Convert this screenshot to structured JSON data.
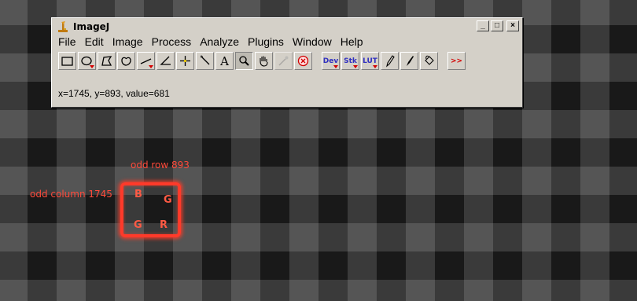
{
  "window": {
    "title": "ImageJ",
    "buttons": {
      "minimize": "_",
      "maximize": "□",
      "close": "×"
    }
  },
  "menu": [
    "File",
    "Edit",
    "Image",
    "Process",
    "Analyze",
    "Plugins",
    "Window",
    "Help"
  ],
  "toolbar": {
    "tools": [
      {
        "icon": "rectangle-selection-icon"
      },
      {
        "icon": "oval-selection-icon"
      },
      {
        "icon": "polygon-selection-icon"
      },
      {
        "icon": "freehand-selection-icon"
      },
      {
        "icon": "line-selection-icon"
      },
      {
        "icon": "angle-tool-icon"
      },
      {
        "icon": "point-tool-icon"
      },
      {
        "icon": "wand-tool-icon"
      },
      {
        "icon": "text-tool-icon",
        "label": "A"
      },
      {
        "icon": "magnifier-icon",
        "pressed": true
      },
      {
        "icon": "hand-scroll-icon"
      },
      {
        "icon": "color-picker-icon"
      },
      {
        "icon": "stop-icon"
      },
      {
        "icon": "developer-menu-icon",
        "label": "Dev"
      },
      {
        "icon": "stack-menu-icon",
        "label": "Stk"
      },
      {
        "icon": "lut-menu-icon",
        "label": "LUT"
      },
      {
        "icon": "pencil-icon"
      },
      {
        "icon": "paintbrush-icon"
      },
      {
        "icon": "flood-fill-icon"
      },
      {
        "icon": "more-tools-icon",
        "label": ">>"
      }
    ]
  },
  "status": "x=1745, y=893, value=681",
  "annotations": {
    "row_label": "odd row 893",
    "column_label": "odd column 1745",
    "cells": {
      "top_left": "B",
      "top_right": "G",
      "bottom_left": "G",
      "bottom_right": "R"
    },
    "color": "#ff3a2a"
  },
  "colors": {
    "background_dark": "#191919",
    "background_light": "#555555",
    "window_face": "#d4d0c8"
  }
}
